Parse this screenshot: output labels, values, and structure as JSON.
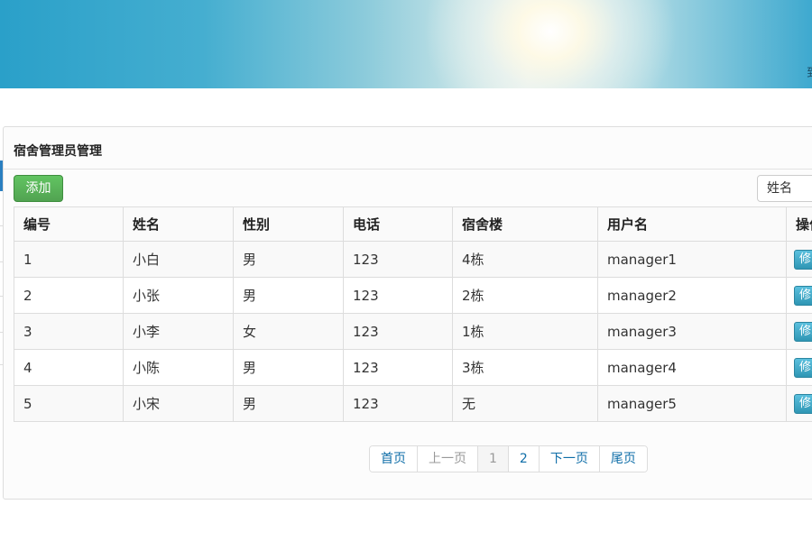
{
  "banner": {
    "corner_text": "到"
  },
  "panel": {
    "title": "宿舍管理员管理",
    "add_button": "添加",
    "search_field": "姓名"
  },
  "table": {
    "headers": [
      "编号",
      "姓名",
      "性别",
      "电话",
      "宿舍楼",
      "用户名",
      "操作"
    ],
    "rows": [
      {
        "id": "1",
        "name": "小白",
        "gender": "男",
        "phone": "123",
        "building": "4栋",
        "username": "manager1",
        "action": "修改"
      },
      {
        "id": "2",
        "name": "小张",
        "gender": "男",
        "phone": "123",
        "building": "2栋",
        "username": "manager2",
        "action": "修改"
      },
      {
        "id": "3",
        "name": "小李",
        "gender": "女",
        "phone": "123",
        "building": "1栋",
        "username": "manager3",
        "action": "修改"
      },
      {
        "id": "4",
        "name": "小陈",
        "gender": "男",
        "phone": "123",
        "building": "3栋",
        "username": "manager4",
        "action": "修改"
      },
      {
        "id": "5",
        "name": "小宋",
        "gender": "男",
        "phone": "123",
        "building": "无",
        "username": "manager5",
        "action": "修改"
      }
    ]
  },
  "pagination": {
    "first": "首页",
    "prev": "上一页",
    "pages": [
      "1",
      "2"
    ],
    "current": "1",
    "next": "下一页",
    "last": "尾页"
  },
  "colors": {
    "add_button": "#5cb85c",
    "edit_button": "#49afcd",
    "link": "#0f6ea8"
  }
}
